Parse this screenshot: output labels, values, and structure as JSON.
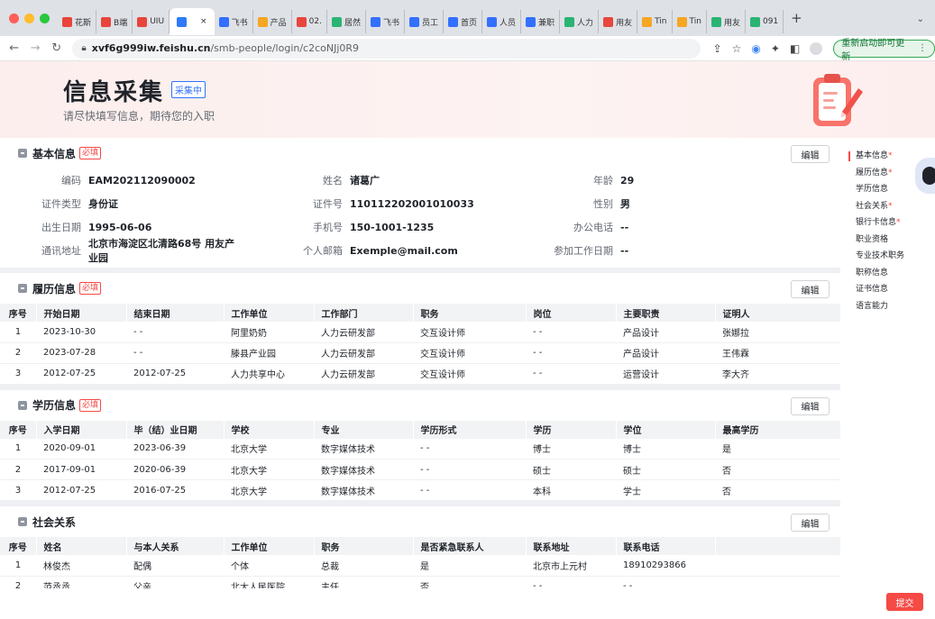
{
  "browser": {
    "tabs": [
      {
        "label": "花斯",
        "color": "#e8453c"
      },
      {
        "label": "B端",
        "color": "#e8453c"
      },
      {
        "label": "UIU",
        "color": "#e8453c"
      },
      {
        "label": "",
        "color": "#2f7af8"
      },
      {
        "label": "飞书",
        "color": "#3370ff"
      },
      {
        "label": "产品",
        "color": "#f5a623"
      },
      {
        "label": "02.",
        "color": "#e8453c"
      },
      {
        "label": "居然",
        "color": "#29b473"
      },
      {
        "label": "飞书",
        "color": "#3370ff"
      },
      {
        "label": "员工",
        "color": "#3370ff"
      },
      {
        "label": "首页",
        "color": "#3370ff"
      },
      {
        "label": "人员",
        "color": "#3370ff"
      },
      {
        "label": "兼职",
        "color": "#3370ff"
      },
      {
        "label": "人力",
        "color": "#29b473"
      },
      {
        "label": "用友",
        "color": "#e8453c"
      },
      {
        "label": "Tin",
        "color": "#f5a623"
      },
      {
        "label": "Tin",
        "color": "#f5a623"
      },
      {
        "label": "用友",
        "color": "#29b473"
      },
      {
        "label": "091",
        "color": "#29b473"
      }
    ],
    "tab_close": "×",
    "new_tab": "+",
    "tab_menu": "⌄",
    "url_host": "xvf6g999iw.feishu.cn",
    "url_path": "/smb-people/login/c2coNJj0R9",
    "update_button": "重新启动即可更新",
    "update_more": "⋮"
  },
  "banner": {
    "title": "信息采集",
    "status": "采集中",
    "subtitle": "请尽快填写信息，期待您的入职"
  },
  "basic": {
    "title": "基本信息",
    "required": "必填",
    "edit": "编辑",
    "rows": [
      [
        {
          "label": "编码",
          "value": "EAM202112090002"
        },
        {
          "label": "姓名",
          "value": "诸葛广"
        },
        {
          "label": "年龄",
          "value": "29"
        }
      ],
      [
        {
          "label": "证件类型",
          "value": "身份证"
        },
        {
          "label": "证件号",
          "value": "110112202001010033"
        },
        {
          "label": "性别",
          "value": "男"
        }
      ],
      [
        {
          "label": "出生日期",
          "value": "1995-06-06"
        },
        {
          "label": "手机号",
          "value": "150-1001-1235"
        },
        {
          "label": "办公电话",
          "value": "--"
        }
      ],
      [
        {
          "label": "通讯地址",
          "value": "北京市海淀区北清路68号 用友产业园"
        },
        {
          "label": "个人邮箱",
          "value": "Exemple@mail.com"
        },
        {
          "label": "参加工作日期",
          "value": "--"
        }
      ]
    ]
  },
  "resume": {
    "title": "履历信息",
    "required": "必填",
    "edit": "编辑",
    "columns": [
      "序号",
      "开始日期",
      "结束日期",
      "工作单位",
      "工作部门",
      "职务",
      "岗位",
      "主要职责",
      "证明人"
    ],
    "rows": [
      [
        "1",
        "2023-10-30",
        "- -",
        "阿里奶奶",
        "人力云研发部",
        "交互设计师",
        "- -",
        "产品设计",
        "张娜拉"
      ],
      [
        "2",
        "2023-07-28",
        "- -",
        "滕县产业园",
        "人力云研发部",
        "交互设计师",
        "- -",
        "产品设计",
        "王伟霖"
      ],
      [
        "3",
        "2012-07-25",
        "2012-07-25",
        "人力共享中心",
        "人力云研发部",
        "交互设计师",
        "- -",
        "运营设计",
        "李大齐"
      ]
    ]
  },
  "education": {
    "title": "学历信息",
    "required": "必填",
    "edit": "编辑",
    "columns": [
      "序号",
      "入学日期",
      "毕（结）业日期",
      "学校",
      "专业",
      "学历形式",
      "学历",
      "学位",
      "最高学历"
    ],
    "rows": [
      [
        "1",
        "2020-09-01",
        "2023-06-39",
        "北京大学",
        "数字媒体技术",
        "- -",
        "博士",
        "博士",
        "是"
      ],
      [
        "2",
        "2017-09-01",
        "2020-06-39",
        "北京大学",
        "数字媒体技术",
        "- -",
        "硕士",
        "硕士",
        "否"
      ],
      [
        "3",
        "2012-07-25",
        "2016-07-25",
        "北京大学",
        "数字媒体技术",
        "- -",
        "本科",
        "学士",
        "否"
      ]
    ]
  },
  "social": {
    "title": "社会关系",
    "edit": "编辑",
    "columns": [
      "序号",
      "姓名",
      "与本人关系",
      "工作单位",
      "职务",
      "是否紧急联系人",
      "联系地址",
      "联系电话",
      ""
    ],
    "rows": [
      [
        "1",
        "林俊杰",
        "配偶",
        "个体",
        "总裁",
        "是",
        "北京市上元村",
        "18910293866",
        ""
      ],
      [
        "2",
        "范丞丞",
        "父亲",
        "北大人民医院",
        "主任",
        "否",
        "- -",
        "- -",
        ""
      ]
    ]
  },
  "side_nav": [
    {
      "label": "基本信息",
      "star": "*"
    },
    {
      "label": "履历信息",
      "star": "*"
    },
    {
      "label": "学历信息",
      "star": ""
    },
    {
      "label": "社会关系",
      "star": "*"
    },
    {
      "label": "银行卡信息",
      "star": "*"
    },
    {
      "label": "职业资格",
      "star": ""
    },
    {
      "label": "专业技术职务",
      "star": ""
    },
    {
      "label": "职称信息",
      "star": ""
    },
    {
      "label": "证书信息",
      "star": ""
    },
    {
      "label": "语言能力",
      "star": ""
    }
  ],
  "submit": "提交"
}
